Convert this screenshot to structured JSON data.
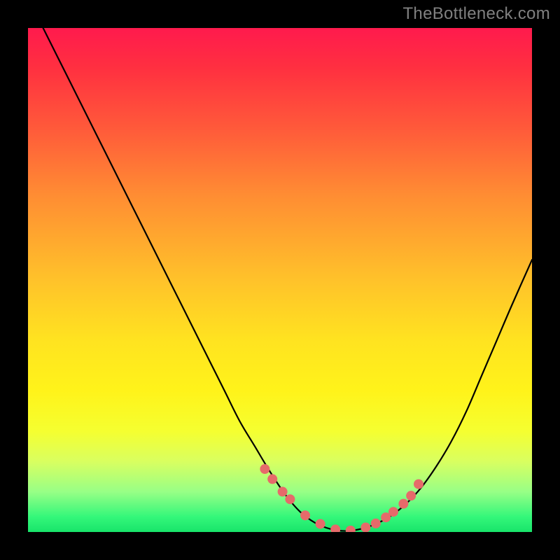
{
  "watermark": "TheBottleneck.com",
  "colors": {
    "curve": "#000000",
    "marker_fill": "#e66a6a",
    "marker_stroke": "#e66a6a"
  },
  "chart_data": {
    "type": "line",
    "title": "",
    "xlabel": "",
    "ylabel": "",
    "xlim": [
      0,
      100
    ],
    "ylim": [
      0,
      100
    ],
    "grid": false,
    "series": [
      {
        "name": "bottleneck-curve",
        "x": [
          0,
          3,
          6,
          9,
          12,
          15,
          18,
          21,
          24,
          27,
          30,
          33,
          36,
          39,
          42,
          45,
          48,
          51,
          54,
          57,
          60,
          63,
          66,
          69,
          72,
          75,
          78,
          81,
          84,
          87,
          90,
          93,
          96,
          100
        ],
        "y": [
          106,
          100,
          94,
          88,
          82,
          76,
          70,
          64,
          58,
          52,
          46,
          40,
          34,
          28,
          22,
          17,
          12,
          7.5,
          4,
          1.8,
          0.6,
          0.2,
          0.6,
          1.6,
          3.2,
          5.6,
          8.8,
          13,
          18,
          24,
          31,
          38,
          45,
          54
        ]
      }
    ],
    "markers": {
      "name": "highlighted-points",
      "x": [
        47,
        48.5,
        50.5,
        52,
        55,
        58,
        61,
        64,
        67,
        69,
        71,
        72.5,
        74.5,
        76,
        77.5
      ],
      "y": [
        12.5,
        10.5,
        8,
        6.5,
        3.3,
        1.6,
        0.5,
        0.3,
        0.9,
        1.7,
        2.9,
        4.0,
        5.6,
        7.2,
        9.5
      ]
    }
  }
}
